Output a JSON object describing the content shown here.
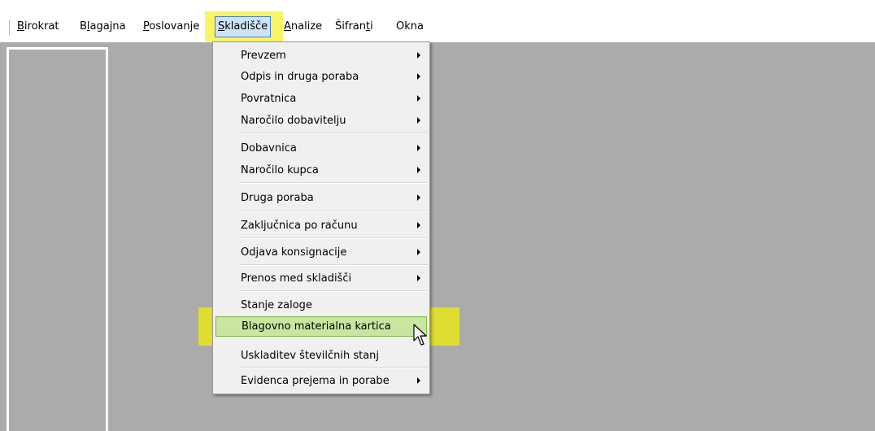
{
  "menubar": {
    "items": [
      {
        "pre": "",
        "u": "B",
        "post": "irokrat"
      },
      {
        "pre": "B",
        "u": "l",
        "post": "agajna"
      },
      {
        "pre": "",
        "u": "P",
        "post": "oslovanje"
      },
      {
        "pre": "",
        "u": "S",
        "post": "kladišče"
      },
      {
        "pre": "",
        "u": "A",
        "post": "nalize"
      },
      {
        "pre": "Šifran",
        "u": "t",
        "post": "i"
      },
      {
        "pre": "Okna",
        "u": "",
        "post": ""
      }
    ]
  },
  "dropdown": {
    "items": [
      {
        "label": "Prevzem",
        "submenu": true
      },
      {
        "label": "Odpis in druga poraba",
        "submenu": true
      },
      {
        "label": "Povratnica",
        "submenu": true
      },
      {
        "label": "Naročilo dobavitelju",
        "submenu": true
      },
      {
        "label": "Dobavnica",
        "submenu": true
      },
      {
        "label": "Naročilo kupca",
        "submenu": true
      },
      {
        "label": "Druga poraba",
        "submenu": true
      },
      {
        "label": "Zaključnica po računu",
        "submenu": true
      },
      {
        "label": "Odjava konsignacije",
        "submenu": true
      },
      {
        "label": "Prenos med skladišči",
        "submenu": true
      },
      {
        "label": "Stanje zaloge",
        "submenu": false
      },
      {
        "label": "Blagovno materialna kartica",
        "submenu": false,
        "hovered": true
      },
      {
        "label": "Uskladitev številčnih stanj",
        "submenu": false
      },
      {
        "label": "Evidenca prejema in porabe",
        "submenu": true
      }
    ]
  },
  "colors": {
    "highlight": "#f3f000",
    "workspace": "#ababab",
    "hover_fill": "#c8e6a0"
  },
  "icons": {
    "cursor": "mouse-pointer-icon"
  }
}
